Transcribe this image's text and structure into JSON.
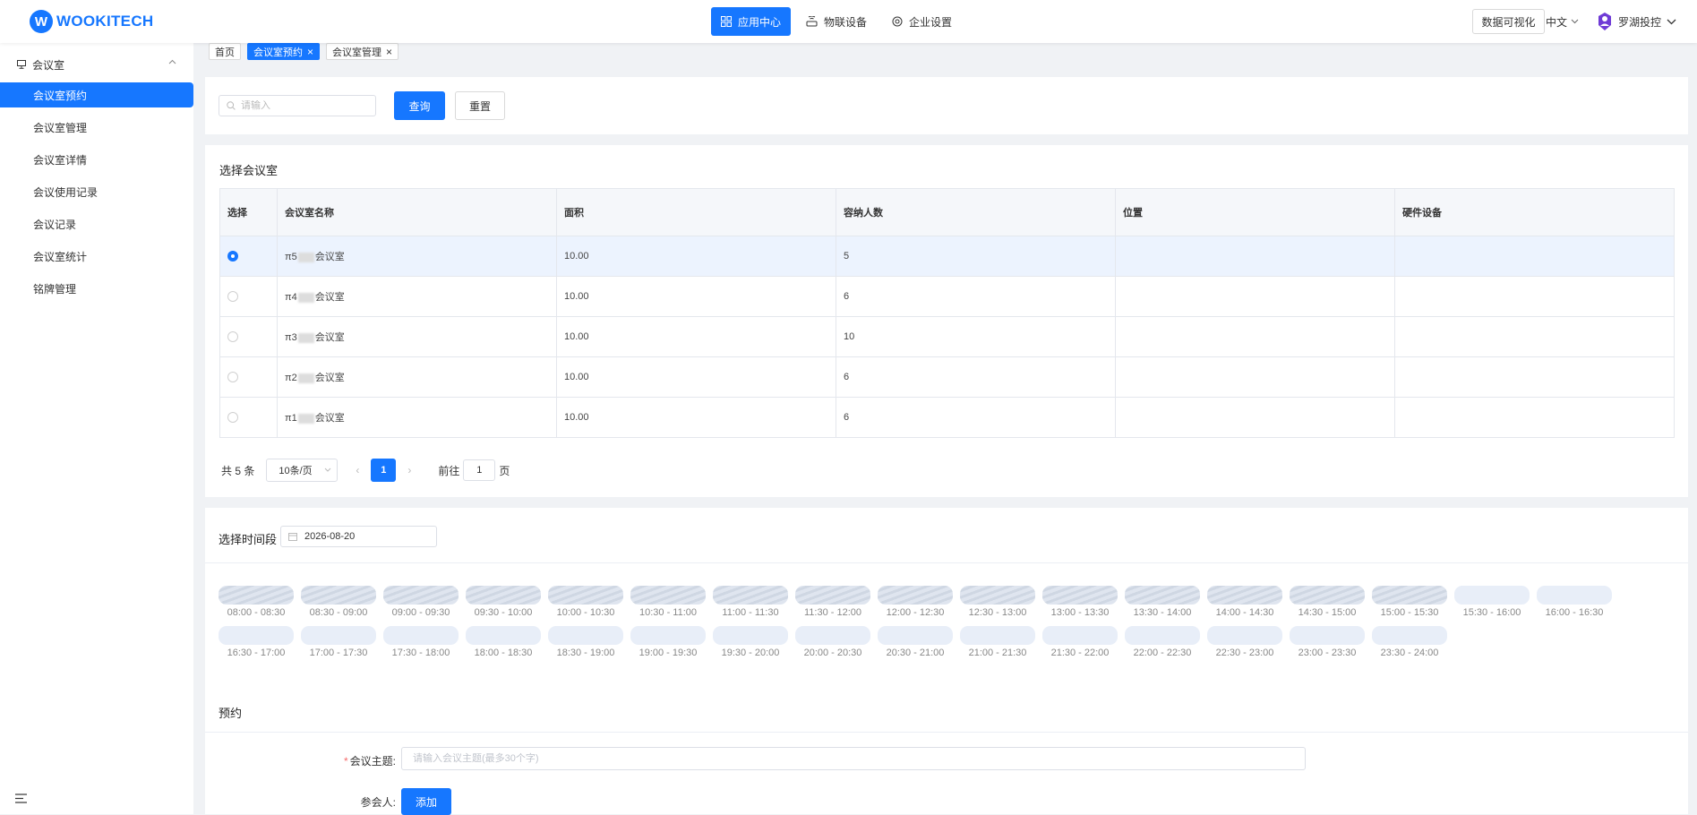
{
  "brand": {
    "logo_text": "WOOKITECH",
    "accent": "#1677ff"
  },
  "topnav": [
    {
      "label": "应用中心",
      "icon": "grid-icon",
      "active": true
    },
    {
      "label": "物联设备",
      "icon": "iot-device-icon",
      "active": false
    },
    {
      "label": "企业设置",
      "icon": "gear-icon",
      "active": false
    }
  ],
  "header": {
    "visual_button": "数据可视化",
    "language": "中文",
    "username": "罗湖投控"
  },
  "sidebar": {
    "group": "会议室",
    "items": [
      {
        "label": "会议室预约",
        "active": true
      },
      {
        "label": "会议室管理",
        "active": false
      },
      {
        "label": "会议室详情",
        "active": false
      },
      {
        "label": "会议使用记录",
        "active": false
      },
      {
        "label": "会议记录",
        "active": false
      },
      {
        "label": "会议室统计",
        "active": false
      },
      {
        "label": "铭牌管理",
        "active": false
      }
    ]
  },
  "tags": [
    {
      "label": "首页",
      "active": false,
      "closable": false
    },
    {
      "label": "会议室预约",
      "active": true,
      "closable": true
    },
    {
      "label": "会议室管理",
      "active": false,
      "closable": true
    }
  ],
  "search": {
    "placeholder": "请输入",
    "query_label": "查询",
    "reset_label": "重置"
  },
  "rooms": {
    "title": "选择会议室",
    "columns": [
      "选择",
      "会议室名称",
      "面积",
      "容纳人数",
      "位置",
      "硬件设备"
    ],
    "rows": [
      {
        "selected": true,
        "name_prefix": "π5",
        "name_suffix": "会议室",
        "area": "10.00",
        "capacity": "5",
        "location": "",
        "hardware": ""
      },
      {
        "selected": false,
        "name_prefix": "π4",
        "name_suffix": "会议室",
        "area": "10.00",
        "capacity": "6",
        "location": "",
        "hardware": ""
      },
      {
        "selected": false,
        "name_prefix": "π3",
        "name_suffix": "会议室",
        "area": "10.00",
        "capacity": "10",
        "location": "",
        "hardware": ""
      },
      {
        "selected": false,
        "name_prefix": "π2",
        "name_suffix": "会议室",
        "area": "10.00",
        "capacity": "6",
        "location": "",
        "hardware": ""
      },
      {
        "selected": false,
        "name_prefix": "π1",
        "name_suffix": "会议室",
        "area": "10.00",
        "capacity": "6",
        "location": "",
        "hardware": ""
      }
    ],
    "pagination": {
      "total": "共 5 条",
      "page_size": "10条/页",
      "current": "1",
      "goto_prefix": "前往",
      "goto_value": "1",
      "goto_suffix": "页"
    }
  },
  "times": {
    "title": "选择时间段",
    "date": "2026-08-20",
    "slots": [
      {
        "label": "08:00 - 08:30",
        "booked": true
      },
      {
        "label": "08:30 - 09:00",
        "booked": true
      },
      {
        "label": "09:00 - 09:30",
        "booked": true
      },
      {
        "label": "09:30 - 10:00",
        "booked": true
      },
      {
        "label": "10:00 - 10:30",
        "booked": true
      },
      {
        "label": "10:30 - 11:00",
        "booked": true
      },
      {
        "label": "11:00 - 11:30",
        "booked": true
      },
      {
        "label": "11:30 - 12:00",
        "booked": true
      },
      {
        "label": "12:00 - 12:30",
        "booked": true
      },
      {
        "label": "12:30 - 13:00",
        "booked": true
      },
      {
        "label": "13:00 - 13:30",
        "booked": true
      },
      {
        "label": "13:30 - 14:00",
        "booked": true
      },
      {
        "label": "14:00 - 14:30",
        "booked": true
      },
      {
        "label": "14:30 - 15:00",
        "booked": true
      },
      {
        "label": "15:00 - 15:30",
        "booked": true
      },
      {
        "label": "15:30 - 16:00",
        "booked": false
      },
      {
        "label": "16:00 - 16:30",
        "booked": false
      },
      {
        "label": "16:30 - 17:00",
        "booked": false
      },
      {
        "label": "17:00 - 17:30",
        "booked": false
      },
      {
        "label": "17:30 - 18:00",
        "booked": false
      },
      {
        "label": "18:00 - 18:30",
        "booked": false
      },
      {
        "label": "18:30 - 19:00",
        "booked": false
      },
      {
        "label": "19:00 - 19:30",
        "booked": false
      },
      {
        "label": "19:30 - 20:00",
        "booked": false
      },
      {
        "label": "20:00 - 20:30",
        "booked": false
      },
      {
        "label": "20:30 - 21:00",
        "booked": false
      },
      {
        "label": "21:00 - 21:30",
        "booked": false
      },
      {
        "label": "21:30 - 22:00",
        "booked": false
      },
      {
        "label": "22:00 - 22:30",
        "booked": false
      },
      {
        "label": "22:30 - 23:00",
        "booked": false
      },
      {
        "label": "23:00 - 23:30",
        "booked": false
      },
      {
        "label": "23:30 - 24:00",
        "booked": false
      }
    ]
  },
  "booking": {
    "title": "预约",
    "subject_label": "会议主题:",
    "subject_placeholder": "请输入会议主题(最多30个字)",
    "participants_label": "参会人:",
    "add_label": "添加"
  }
}
